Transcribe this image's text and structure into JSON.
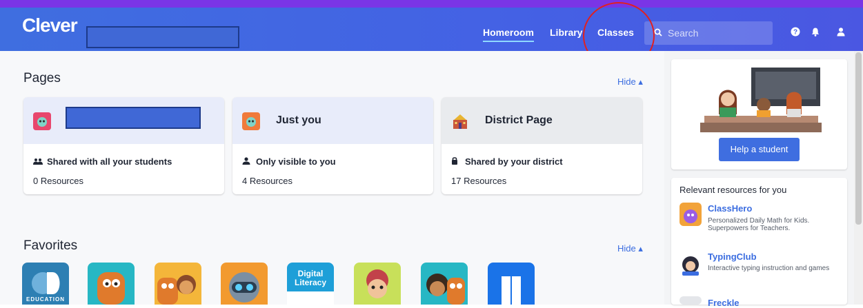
{
  "header": {
    "logo": "Clever",
    "nav": [
      "Homeroom",
      "Library",
      "Classes"
    ],
    "search_placeholder": "Search"
  },
  "pages": {
    "title": "Pages",
    "hide_label": "Hide ▴",
    "cards": [
      {
        "name": "",
        "share": "Shared with all your students",
        "resources": "0 Resources"
      },
      {
        "name": "Just you",
        "share": "Only visible to you",
        "resources": "4 Resources"
      },
      {
        "name": "District Page",
        "share": "Shared by your district",
        "resources": "17 Resources"
      }
    ]
  },
  "help": {
    "button": "Help a student"
  },
  "relevant": {
    "title": "Relevant resources for you",
    "items": [
      {
        "name": "ClassHero",
        "desc": "Personalized Daily Math for Kids. Superpowers for Teachers."
      },
      {
        "name": "TypingClub",
        "desc": "Interactive typing instruction and games"
      },
      {
        "name": "Freckle",
        "desc": ""
      }
    ]
  },
  "favorites": {
    "title": "Favorites",
    "hide_label": "Hide ▴",
    "apps": [
      {
        "label": "EDUCATION"
      },
      {
        "label": ""
      },
      {
        "label": ""
      },
      {
        "label": ""
      },
      {
        "label": "Digital Literacy"
      },
      {
        "label": ""
      },
      {
        "label": ""
      },
      {
        "label": ""
      }
    ]
  },
  "colors": {
    "accent": "#3f6ee0",
    "topstrip": "#7a35e6",
    "highlight_circle": "#e02020"
  }
}
